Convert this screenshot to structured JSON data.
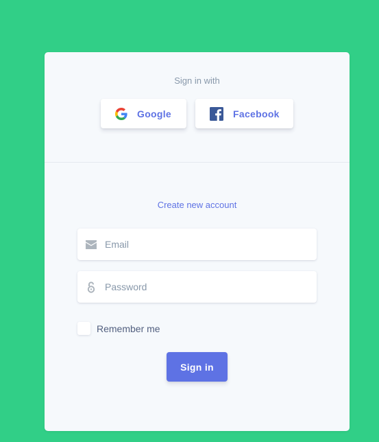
{
  "colors": {
    "background": "#31cf87",
    "card": "#f6f9fc",
    "primary": "#5e72e4",
    "muted": "#8898aa",
    "text": "#525f7f"
  },
  "social": {
    "heading": "Sign in with",
    "google_label": "Google",
    "google_icon": "google-logo-icon",
    "facebook_label": "Facebook",
    "facebook_icon": "facebook-logo-icon"
  },
  "form": {
    "create_account_link": "Create new account",
    "email": {
      "placeholder": "Email",
      "value": "",
      "icon": "envelope-icon"
    },
    "password": {
      "placeholder": "Password",
      "value": "",
      "icon": "unlock-icon"
    },
    "remember_label": "Remember me",
    "remember_checked": false,
    "submit_label": "Sign in"
  }
}
